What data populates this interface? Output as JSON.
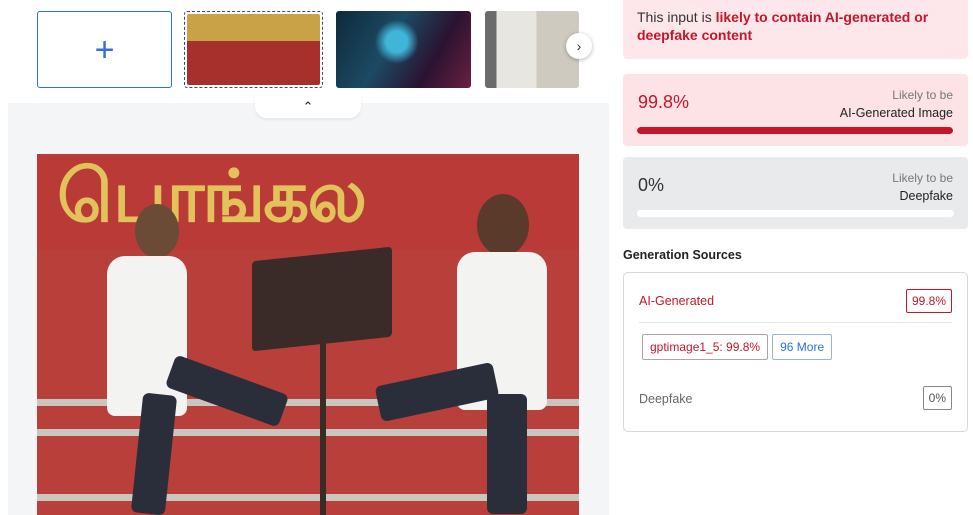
{
  "gallery": {
    "add_label": "+",
    "next_icon": "chevron-right-icon",
    "collapse_icon": "chevron-up-icon",
    "thumbnails": [
      "thumb-1",
      "thumb-2",
      "thumb-3"
    ]
  },
  "image": {
    "sign_text": "பொங்கல"
  },
  "alert": {
    "prefix": "This input is ",
    "highlight": "likely to contain AI-generated or deepfake content"
  },
  "ai_card": {
    "percent": "99.8%",
    "likely_label": "Likely to be",
    "type_label": "AI-Generated Image",
    "progress": 0.998
  },
  "deepfake_card": {
    "percent": "0%",
    "likely_label": "Likely to be",
    "type_label": "Deepfake",
    "progress": 0
  },
  "sources": {
    "title": "Generation Sources",
    "ai_label": "AI-Generated",
    "ai_badge": "99.8%",
    "model_chip": "gptimage1_5: 99.8%",
    "more_chip": "96 More",
    "deepfake_label": "Deepfake",
    "deepfake_badge": "0%"
  },
  "colors": {
    "accent_red": "#c4162a",
    "accent_blue": "#2f6fd6"
  }
}
